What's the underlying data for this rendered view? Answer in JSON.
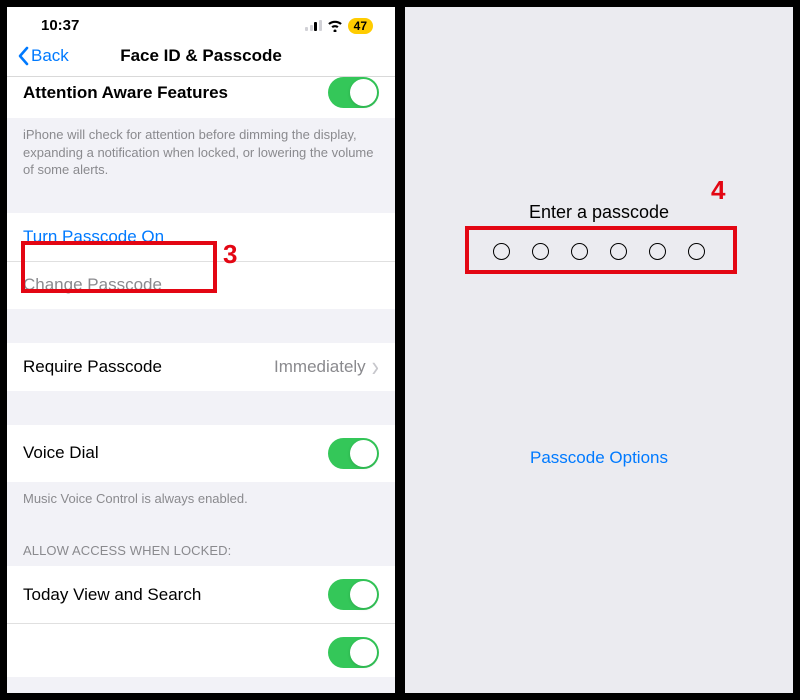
{
  "status": {
    "time": "10:37",
    "battery": "47"
  },
  "nav": {
    "back": "Back",
    "title": "Face ID & Passcode"
  },
  "attention": {
    "title": "Attention Aware Features",
    "footer": "iPhone will check for attention before dimming the display, expanding a notification when locked, or lowering the volume of some alerts."
  },
  "passcode": {
    "turn_on": "Turn Passcode On",
    "change": "Change Passcode",
    "require_label": "Require Passcode",
    "require_value": "Immediately"
  },
  "voice_dial": {
    "label": "Voice Dial",
    "footer": "Music Voice Control is always enabled."
  },
  "locked_header": "ALLOW ACCESS WHEN LOCKED:",
  "locked_items": {
    "today": "Today View and Search"
  },
  "annotations": {
    "step3": "3",
    "step4": "4"
  },
  "right": {
    "title": "Enter a passcode",
    "options": "Passcode Options"
  }
}
